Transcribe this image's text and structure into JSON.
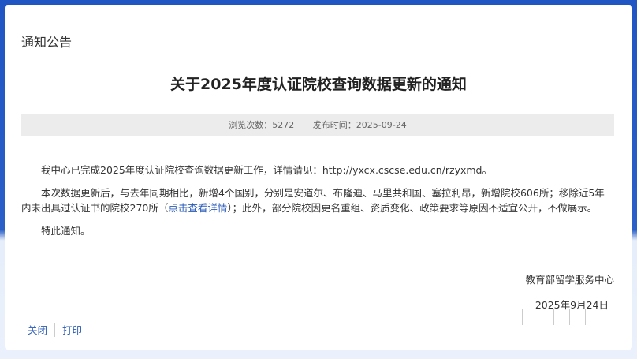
{
  "section_title": "通知公告",
  "article": {
    "title": "关于2025年度认证院校查询数据更新的通知",
    "views_label": "浏览次数：",
    "views": "5272",
    "published_label": "发布时间：",
    "published": "2025-09-24",
    "paragraph1": "我中心已完成2025年度认证院校查询数据更新工作，详情请见：http://yxcx.cscse.edu.cn/rzyxmd。",
    "paragraph2_a": "本次数据更新后，与去年同期相比，新增4个国别，分别是安道尔、布隆迪、马里共和国、塞拉利昂，新增院校606所；移除近5年内未出具过认证书的院校270所（",
    "paragraph2_link": "点击查看详情",
    "paragraph2_b": "）；此外，部分院校因更名重组、资质变化、政策要求等原因不适宜公开，不做展示。",
    "paragraph3": "特此通知。",
    "signature": "教育部留学服务中心",
    "date": "2025年9月24日"
  },
  "actions": {
    "close": "关闭",
    "print": "打印"
  }
}
